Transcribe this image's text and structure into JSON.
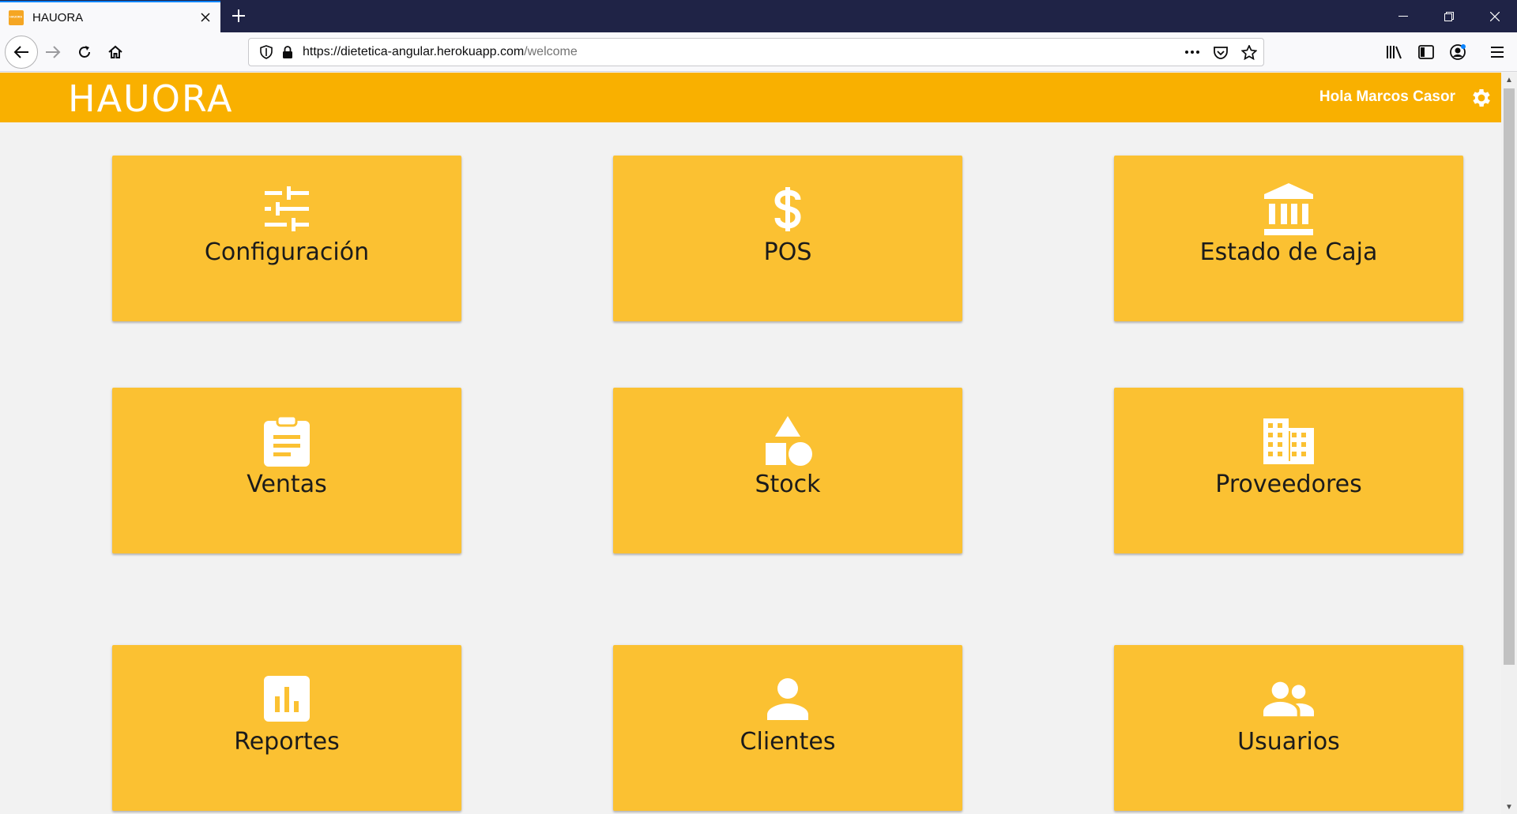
{
  "browser": {
    "tab_title": "HAUORA",
    "favicon_text": "HAUORA",
    "url_host": "https://dietetica-angular.herokuapp.com",
    "url_path": "/welcome"
  },
  "header": {
    "logo": "HAUORA",
    "greeting": "Hola Marcos Casor",
    "background": "#f9b000"
  },
  "cards": [
    {
      "label": "Configuración",
      "icon": "tune-icon"
    },
    {
      "label": "POS",
      "icon": "dollar-icon"
    },
    {
      "label": "Estado de Caja",
      "icon": "bank-icon"
    },
    {
      "label": "Ventas",
      "icon": "clipboard-icon"
    },
    {
      "label": "Stock",
      "icon": "shapes-icon"
    },
    {
      "label": "Proveedores",
      "icon": "building-icon"
    },
    {
      "label": "Reportes",
      "icon": "bar-chart-icon"
    },
    {
      "label": "Clientes",
      "icon": "person-icon"
    },
    {
      "label": "Usuarios",
      "icon": "people-icon"
    }
  ],
  "card_color": "#fbc132"
}
